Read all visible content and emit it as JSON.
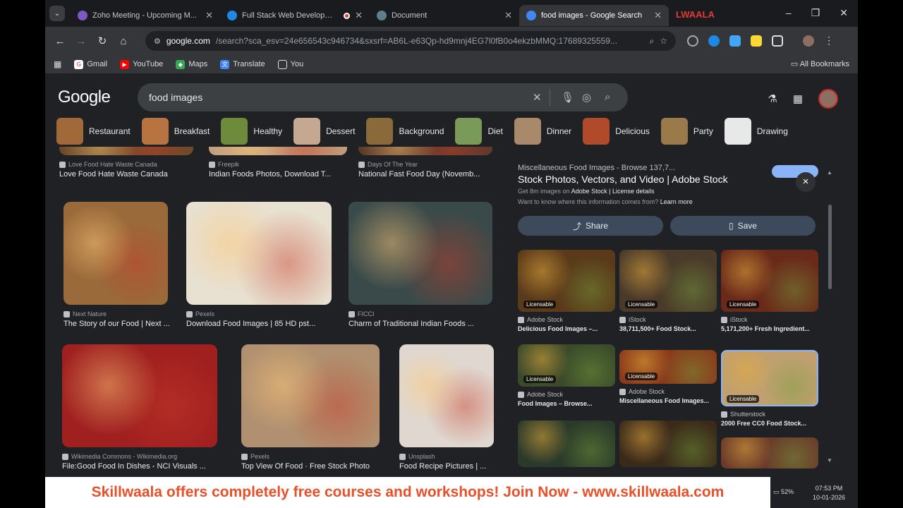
{
  "browser": {
    "tabs": [
      {
        "title": "Zoho Meeting - Upcoming M...",
        "favicon_color": "#7e57c2",
        "active": false,
        "recording": false
      },
      {
        "title": "Full Stack Web Developmen",
        "favicon_color": "#1e88e5",
        "active": false,
        "recording": true
      },
      {
        "title": "Document",
        "favicon_color": "#607d8b",
        "active": false,
        "recording": false
      },
      {
        "title": "food images - Google Search",
        "favicon_color": "#4285f4",
        "active": true,
        "recording": false
      }
    ],
    "brand_overlay": "LWAALA",
    "address": {
      "domain": "google.com",
      "path": "/search?sca_esv=24e656543c946734&sxsrf=AB6L-e63Qp-hd9mnj4EG7l0fB0o4ekzbMMQ:17689325559..."
    },
    "bookmarks": [
      "Gmail",
      "YouTube",
      "Maps",
      "Translate",
      "You"
    ],
    "all_bookmarks": "All Bookmarks"
  },
  "google": {
    "logo": "Google",
    "query": "food images",
    "chips": [
      {
        "label": "Restaurant",
        "color": "#a1683a"
      },
      {
        "label": "Breakfast",
        "color": "#b87440"
      },
      {
        "label": "Healthy",
        "color": "#6d8b3a"
      },
      {
        "label": "Dessert",
        "color": "#c4a88f"
      },
      {
        "label": "Background",
        "color": "#8a6a3a"
      },
      {
        "label": "Diet",
        "color": "#7a9a5a"
      },
      {
        "label": "Dinner",
        "color": "#a88a6a"
      },
      {
        "label": "Delicious",
        "color": "#b04a2a"
      },
      {
        "label": "Party",
        "color": "#9a7a4a"
      },
      {
        "label": "Drawing",
        "color": "#e8e8e8"
      }
    ],
    "results": [
      {
        "source": "Love Food Hate Waste Canada",
        "title": "Love Food Hate Waste Canada",
        "color": "#6a4a2a"
      },
      {
        "source": "Freepik",
        "title": "Indian Foods Photos, Download T...",
        "color": "#c0a080"
      },
      {
        "source": "Days Of The Year",
        "title": "National Fast Food Day (Novemb...",
        "color": "#5a3a2a"
      },
      {
        "source": "Next Nature",
        "title": "The Story of our Food | Next ...",
        "color": "#9a6a3a"
      },
      {
        "source": "Pexels",
        "title": "Download Food Images | 85 HD pst...",
        "color": "#e8e0d0"
      },
      {
        "source": "FICCI",
        "title": "Charm of Traditional Indian Foods ...",
        "color": "#3a4a4a"
      },
      {
        "source": "Wikimedia Commons - Wikimedia.org",
        "title": "File:Good Food In Dishes - NCI Visuals ...",
        "color": "#a02020"
      },
      {
        "source": "Pexels",
        "title": "Top View Of Food · Free Stock Photo",
        "color": "#b09070"
      },
      {
        "source": "Unsplash",
        "title": "Food Recipe Pictures | ...",
        "color": "#e0d8d0"
      }
    ],
    "panel": {
      "cut_text": "Miscellaneous Food Images - Browse 137,7...",
      "title": "Stock Photos, Vectors, and Video | Adobe Stock",
      "meta_prefix": "Get 8m images on",
      "meta_link": "Adobe Stock",
      "meta_suffix": "| License details",
      "question": "Want to know where this information comes from?",
      "learn_more": "Learn more",
      "share": "Share",
      "save": "Save",
      "close": "×",
      "related": [
        {
          "source": "Adobe Stock",
          "title": "Delicious Food Images –...",
          "license": "Licensable",
          "color": "#5a3a1a"
        },
        {
          "source": "iStock",
          "title": "38,711,500+ Food Stock...",
          "license": "Licensable",
          "color": "#4a3a2a"
        },
        {
          "source": "iStock",
          "title": "5,171,200+ Fresh Ingredient...",
          "license": "Licensable",
          "color": "#6a2a1a"
        },
        {
          "source": "Adobe Stock",
          "title": "Food Images – Browse...",
          "license": "Licensable",
          "color": "#3a4a2a"
        },
        {
          "source": "Adobe Stock",
          "title": "Miscellaneous Food Images...",
          "license": "Licensable",
          "color": "#8a3a1a"
        },
        {
          "source": "Shutterstock",
          "title": "2000 Free CC0 Food Stock...",
          "license": "Licensable",
          "color": "#c0a070"
        },
        {
          "source": "",
          "title": "",
          "license": "",
          "color": "#2a3a2a"
        },
        {
          "source": "",
          "title": "",
          "license": "",
          "color": "#3a2a1a"
        },
        {
          "source": "",
          "title": "",
          "license": "",
          "color": "#6a3a2a"
        }
      ]
    }
  },
  "banner": "Skillwaala offers completely free courses and workshops! Join Now  - www.skillwaala.com",
  "taskbar": {
    "battery": "52%",
    "time": "07:53 PM",
    "date": "10-01-2026"
  }
}
